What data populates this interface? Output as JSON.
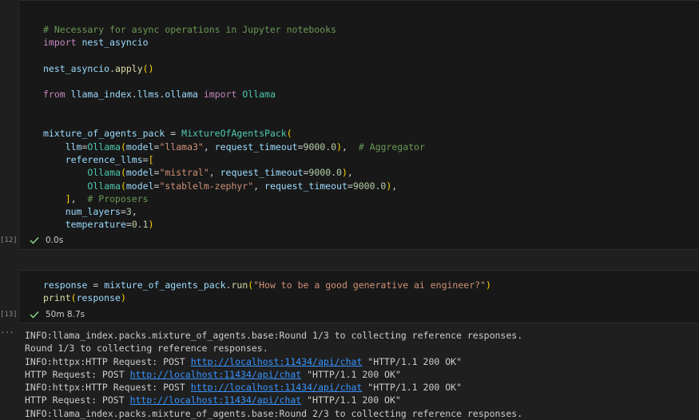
{
  "cell1": {
    "execution_count": "[12]",
    "status_time": "0.0s",
    "lines": [
      "# Necessary for async operations in Jupyter notebooks",
      "import nest_asyncio",
      "",
      "nest_asyncio.apply()",
      "",
      "from llama_index.llms.ollama import Ollama",
      "",
      "",
      "mixture_of_agents_pack = MixtureOfAgentsPack(",
      "    llm=Ollama(model=\"llama3\", request_timeout=9000.0),  # Aggregator",
      "    reference_llms=[",
      "        Ollama(model=\"mistral\", request_timeout=9000.0),",
      "        Ollama(model=\"stablelm-zephyr\", request_timeout=9000.0),",
      "    ],  # Proposers",
      "    num_layers=3,",
      "    temperature=0.1)"
    ]
  },
  "cell2": {
    "execution_count": "[13]",
    "status_time": "50m 8.7s",
    "lines": [
      "response = mixture_of_agents_pack.run(\"How to be a good generative ai engineer?\")",
      "print(response)"
    ]
  },
  "output": {
    "ellipsis": "···",
    "url": "http://localhost:11434/api/chat",
    "lines": [
      "INFO:llama_index.packs.mixture_of_agents.base:Round 1/3 to collecting reference responses.",
      "Round 1/3 to collecting reference responses.",
      "INFO:httpx:HTTP Request: POST http://localhost:11434/api/chat \"HTTP/1.1 200 OK\"",
      "HTTP Request: POST http://localhost:11434/api/chat \"HTTP/1.1 200 OK\"",
      "INFO:httpx:HTTP Request: POST http://localhost:11434/api/chat \"HTTP/1.1 200 OK\"",
      "HTTP Request: POST http://localhost:11434/api/chat \"HTTP/1.1 200 OK\"",
      "INFO:llama_index.packs.mixture_of_agents.base:Round 2/3 to collecting reference responses."
    ]
  },
  "colors": {
    "background": "#1f1f1f",
    "cell_background": "#181818",
    "success_check": "#89d185",
    "link": "#3794ff"
  },
  "icons": {
    "status": "check-icon",
    "output_menu": "ellipsis-icon"
  }
}
